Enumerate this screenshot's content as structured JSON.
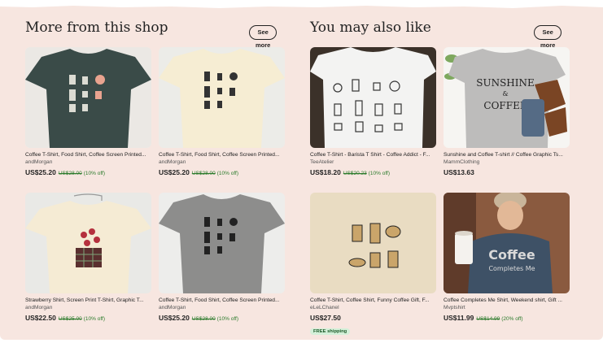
{
  "left_section": {
    "title": "More from this shop",
    "see_more": "See more",
    "items": [
      {
        "title": "Coffee T-Shirt, Food Shirt, Coffee Screen Printed...",
        "shop": "andMorgan",
        "price": "US$25.20",
        "original": "US$28.00",
        "discount": "(10% off)",
        "image": "dark green t-shirt with coffee makers print"
      },
      {
        "title": "Coffee T-Shirt, Food Shirt, Coffee Screen Printed...",
        "shop": "andMorgan",
        "price": "US$25.20",
        "original": "US$28.00",
        "discount": "(10% off)",
        "image": "cream t-shirt with coffee makers print"
      },
      {
        "title": "Strawberry Shirt, Screen Print T-Shirt, Graphic T...",
        "shop": "andMorgan",
        "price": "US$22.50",
        "original": "US$25.00",
        "discount": "(10% off)",
        "image": "cream t-shirt with strawberry basket print on hanger"
      },
      {
        "title": "Coffee T-Shirt, Food Shirt, Coffee Screen Printed...",
        "shop": "andMorgan",
        "price": "US$25.20",
        "original": "US$28.00",
        "discount": "(10% off)",
        "image": "grey t-shirt with coffee makers print"
      }
    ]
  },
  "right_section": {
    "title": "You may also like",
    "see_more": "See more",
    "items": [
      {
        "title": "Coffee T-Shirt - Barista T Shirt - Coffee Addict - F...",
        "shop": "TeeAtelier",
        "price": "US$18.20",
        "original": "US$20.23",
        "discount": "(10% off)",
        "image": "white t-shirt with coffee equipment illustrations"
      },
      {
        "title": "Sunshine and Coffee T-shirt // Coffee Graphic Ts...",
        "shop": "MammClothing",
        "price": "US$13.63",
        "image": "heather grey t-shirt with SUNSHINE & COFFEE text",
        "print_text": [
          "SUNSHINE",
          "&",
          "COFFEE"
        ]
      },
      {
        "title": "Coffee T-Shirt, Coffee Shirt, Funny Coffee Gift, F...",
        "shop": "eLeLChanel",
        "price": "US$27.50",
        "badge": "FREE shipping",
        "image": "tan t-shirt with gold coffee makers print"
      },
      {
        "title": "Coffee Completes Me Shirt, Weekend shirt, Gift ...",
        "shop": "Mvptshirt",
        "price": "US$11.99",
        "original": "US$14.99",
        "discount": "(20% off)",
        "image": "woman in beanie wearing Coffee Completes Me shirt holding cup",
        "print_text": [
          "Coffee",
          "Completes Me"
        ]
      }
    ]
  },
  "colors": {
    "background": "#f7e6e0",
    "sale_green": "#2a7a2a",
    "badge_bg": "#d4f0d9"
  }
}
